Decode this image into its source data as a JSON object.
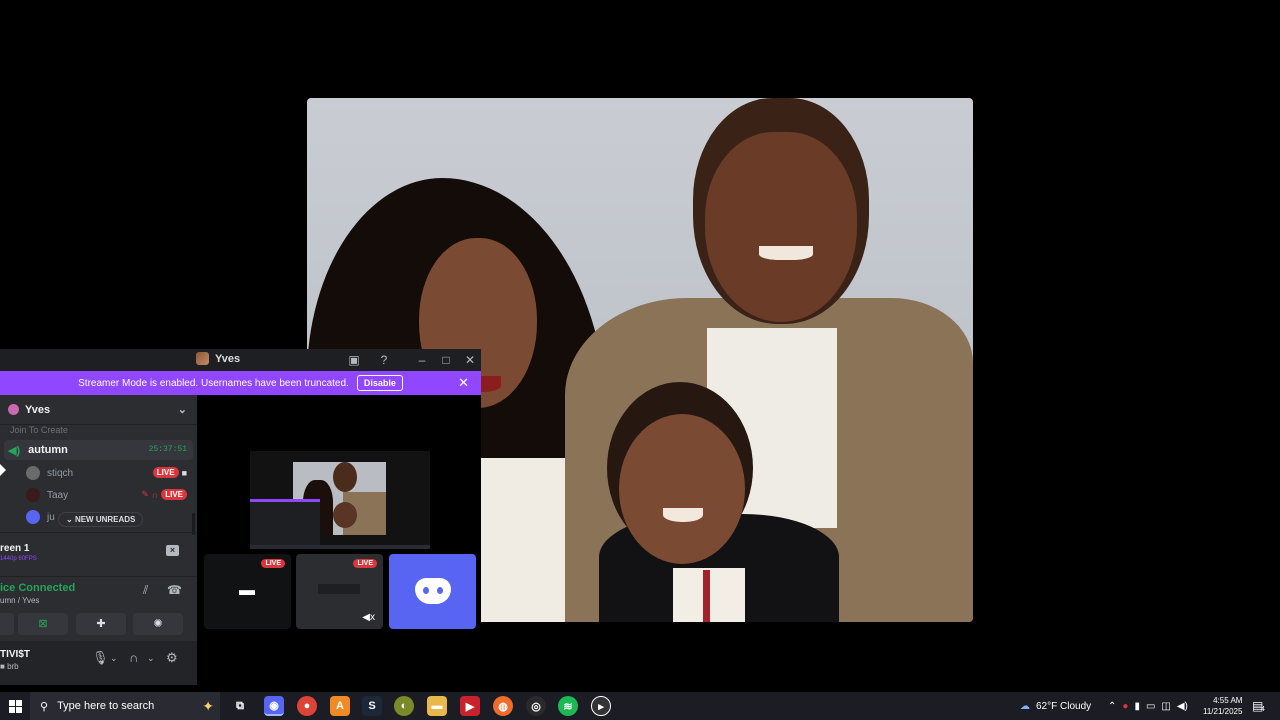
{
  "discord": {
    "window_title": "Yves",
    "banner": {
      "text": "Streamer Mode is enabled. Usernames have been truncated.",
      "disable_label": "Disable"
    },
    "server_name": "Yves",
    "faded_text": "Join To Create",
    "voice_channel": {
      "name": "autumn",
      "timer": "25:37:51"
    },
    "members": [
      {
        "name": "stiqch",
        "live": "LIVE"
      },
      {
        "name": "Taay",
        "live": "LIVE"
      },
      {
        "name": "ju"
      }
    ],
    "new_unreads_label": "NEW UNREADS",
    "screen_panel": {
      "title": "reen 1",
      "subtitle": "1440p 60FPS"
    },
    "voice_panel": {
      "status": "ice Connected",
      "channel": "umn / Yves"
    },
    "user_panel": {
      "name": "TIVI$T",
      "status": "brb"
    },
    "tiles": [
      {
        "live": "LIVE"
      },
      {
        "live": "LIVE"
      }
    ]
  },
  "taskbar": {
    "search_placeholder": "Type here to search",
    "weather": "62°F  Cloudy",
    "time": "4:55 AM",
    "date": "11/21/2025",
    "notifications": "4"
  },
  "colors": {
    "streamer_banner": "#9146ff",
    "connected_green": "#23a55a",
    "live_red": "#da373c",
    "discord_blurple": "#5865f2"
  }
}
